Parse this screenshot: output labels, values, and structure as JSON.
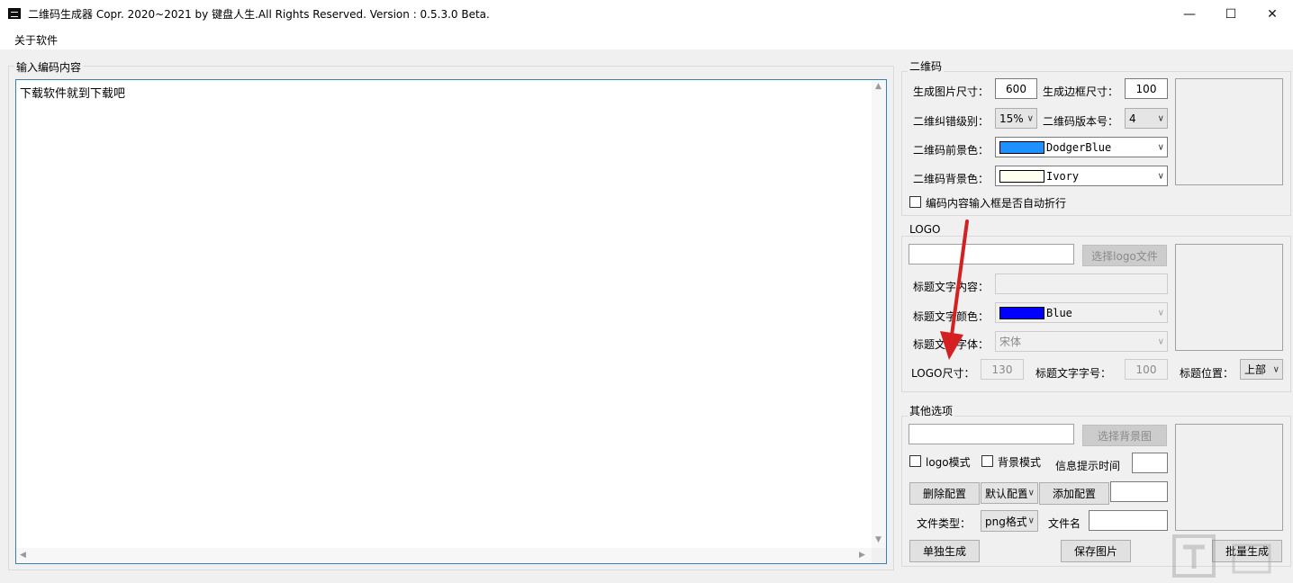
{
  "window": {
    "title": "二维码生成器  Copr. 2020~2021 by 键盘人生.All Rights Reserved.  Version : 0.5.3.0 Beta.",
    "min_glyph": "—",
    "max_glyph": "☐",
    "close_glyph": "✕"
  },
  "menu": {
    "about": "关于软件"
  },
  "input": {
    "legend": "输入编码内容",
    "content": "下载软件就到下载吧"
  },
  "qr": {
    "legend": "二维码",
    "image_size_label": "生成图片尺寸：",
    "image_size": "600",
    "border_size_label": "生成边框尺寸：",
    "border_size": "100",
    "ecc_label": "二维纠错级别：",
    "ecc_value": "15%",
    "version_label": "二维码版本号：",
    "version_value": "4",
    "fg_label": "二维码前景色：",
    "fg_name": "DodgerBlue",
    "fg_color": "#1e90ff",
    "bg_label": "二维码背景色：",
    "bg_name": "Ivory",
    "bg_color": "#fffff0",
    "wrap_label": "编码内容输入框是否自动折行"
  },
  "logo": {
    "legend": "LOGO",
    "choose_button": "选择logo文件",
    "title_text_label": "标题文字内容：",
    "title_color_label": "标题文字颜色：",
    "title_color_name": "Blue",
    "title_color": "#0000ff",
    "title_font_label": "标题文字字体：",
    "title_font_value": "宋体",
    "logo_size_label": "LOGO尺寸：",
    "logo_size": "130",
    "title_font_size_label": "标题文字字号：",
    "title_font_size": "100",
    "title_pos_label": "标题位置：",
    "title_pos_value": "上部"
  },
  "other": {
    "legend": "其他选项",
    "choose_bg_button": "选择背景图",
    "logo_mode_label": "logo模式",
    "bg_mode_label": "背景模式",
    "tip_time_label": "信息提示时间",
    "delete_config_button": "删除配置",
    "config_select_value": "默认配置",
    "add_config_button": "添加配置",
    "file_type_label": "文件类型：",
    "file_type_value": "png格式",
    "file_name_label": "文件名",
    "single_generate_button": "单独生成",
    "save_image_button": "保存图片",
    "batch_generate_button": "批量生成"
  },
  "colors": {
    "arrow": "#d42020",
    "editor_border": "#3c7fb1"
  }
}
